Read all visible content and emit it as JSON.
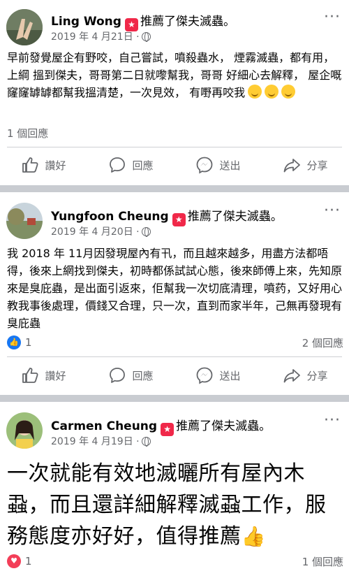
{
  "posts": [
    {
      "author": "Ling Wong",
      "recommend_text": "推薦了傑夫滅蟲。",
      "date": "2019 年 4 月21日 ·",
      "more": "···",
      "body": "早前發覺屋企有野咬，自己嘗試，噴殺蟲水，  煙霧滅蟲，都有用，上綱 搵到傑夫，哥哥第二日就嚟幫我，哥哥 好細心去解釋，  屋企嘅窿窿罅罅都幫我搵清楚，一次見效，  有嘢再咬我",
      "emoji_icon": "smiling-face-emoji",
      "reaction_count": "",
      "comments": "1 個回應",
      "actions": {
        "like": "讚好",
        "comment": "回應",
        "send": "送出",
        "share": "分享"
      }
    },
    {
      "author": "Yungfoon Cheung",
      "recommend_text": "推薦了傑夫滅蟲。",
      "date": "2019 年 4 月20日 ·",
      "more": "···",
      "body": "我 2018 年 11月因發現屋內有卂，而且越來越多，用盡方法都唔得，後來上網找到傑夫，初時都係試試心態，後來師傅上來，先知原來是臭庇蟲，是出面引返來，佢幫我一次切底清理，噴药，又好用心教我事後處理，價錢又合理，只一次，直到而家半年，己無再發現有臭庇蟲",
      "reaction_icon": "like-reaction",
      "reaction_count": "1",
      "comments": "2 個回應",
      "actions": {
        "like": "讚好",
        "comment": "回應",
        "send": "送出",
        "share": "分享"
      }
    },
    {
      "author": "Carmen Cheung",
      "recommend_text": "推薦了傑夫滅蟲。",
      "date": "2019 年 4 月19日 ·",
      "more": "···",
      "body": "一次就能有效地滅曬所有屋內木蝨，而且還詳細解釋滅蝨工作，服務態度亦好好，值得推薦",
      "emoji_icon": "thumbs-up-emoji",
      "reaction_icon": "love-reaction",
      "reaction_count": "1",
      "comments": "1 個回應"
    }
  ],
  "colors": {
    "facebook_blue": "#1877f2",
    "love_red": "#f33e58",
    "badge_red": "#f02849",
    "meta_gray": "#65676b",
    "separator": "#c9ccd1"
  }
}
